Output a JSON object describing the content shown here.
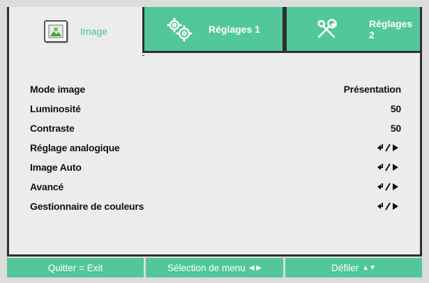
{
  "tabs": [
    {
      "label": "Image",
      "icon": "image-icon",
      "active": true
    },
    {
      "label": "Réglages 1",
      "icon": "gears-icon",
      "active": false
    },
    {
      "label": "Réglages 2",
      "icon": "tools-icon",
      "active": false
    }
  ],
  "settings": [
    {
      "label": "Mode image",
      "value": "Présentation"
    },
    {
      "label": "Luminosité",
      "value": "50"
    },
    {
      "label": "Contraste",
      "value": "50"
    },
    {
      "label": "Réglage analogique",
      "value": "enter-icon"
    },
    {
      "label": "Image Auto",
      "value": "enter-icon"
    },
    {
      "label": "Avancé",
      "value": "enter-icon"
    },
    {
      "label": "Gestionnaire de couleurs",
      "value": "enter-icon"
    }
  ],
  "footer": {
    "quit": "Quitter = Exit",
    "select": "Sélection de menu",
    "select_glyph": "◀ ▶",
    "scroll": "Défiler",
    "scroll_glyph": "▲▼"
  },
  "colors": {
    "accent": "#52c79a",
    "panel": "#ececec",
    "border": "#2f2f2f"
  }
}
